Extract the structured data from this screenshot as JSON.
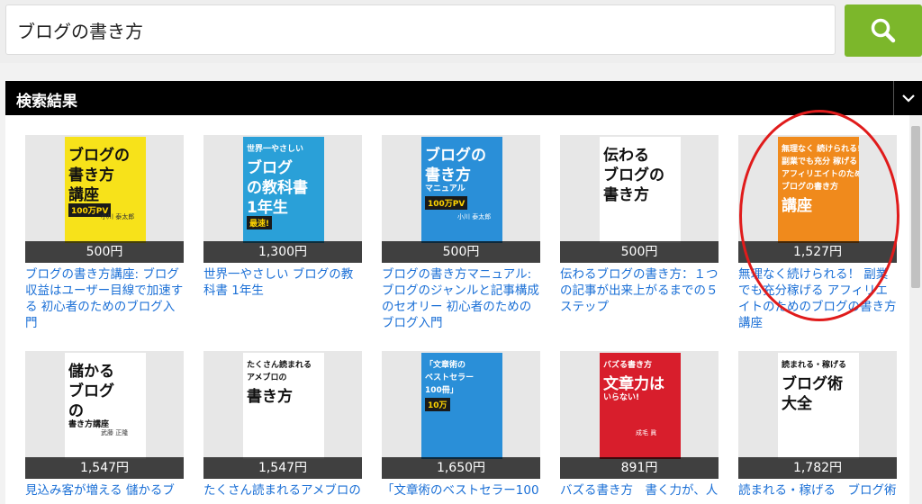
{
  "search": {
    "query": "ブログの書き方",
    "button_icon": "search-icon"
  },
  "results": {
    "header": "検索結果"
  },
  "colors": {
    "accent_green": "#7cb72b",
    "link_blue": "#1a6fd6",
    "annotation_red": "#e01b1b"
  },
  "books": [
    {
      "price": "500円",
      "title": "ブログの書き方講座: ブログ収益はユーザー目線で加速する 初心者のためのブログ入門",
      "cover": {
        "lines": [
          "ブログの",
          "書き方",
          "講座"
        ],
        "author": "小川 泰太郎",
        "banner": "100万PV",
        "bg": "#f7e21a"
      }
    },
    {
      "price": "1,300円",
      "title": "世界一やさしい ブログの教科書 1年生",
      "cover": {
        "lines": [
          "世界一やさしい",
          "ブログ",
          "の教科書",
          "1年生"
        ],
        "author": "",
        "banner": "最速!",
        "bg": "#2aa0d8"
      }
    },
    {
      "price": "500円",
      "title": "ブログの書き方マニュアル: ブログのジャンルと記事構成のセオリー 初心者のためのブログ入門",
      "cover": {
        "lines": [
          "ブログの",
          "書き方",
          "マニュアル"
        ],
        "author": "小川 泰太郎",
        "banner": "100万PV",
        "bg": "#2a8fd8"
      }
    },
    {
      "price": "500円",
      "title": "伝わるブログの書き方：１つの記事が出来上がるまでの５ステップ",
      "cover": {
        "lines": [
          "伝わる",
          "ブログの",
          "書き方"
        ],
        "author": "",
        "banner": "",
        "bg": "#ffffff"
      }
    },
    {
      "price": "1,527円",
      "title": "無理なく続けられる！ 副業でも充分稼げる アフィリエイトのためのブログの書き方講座",
      "cover": {
        "lines": [
          "無理なく 続けられる!",
          "副業でも充分 稼げる",
          "アフィリエイトのための",
          "ブログの書き方",
          "講座"
        ],
        "author": "",
        "banner": "",
        "bg": "#f08a1c"
      }
    },
    {
      "price": "1,547円",
      "title": "見込み客が増える 儲かるブ",
      "cover": {
        "lines": [
          "儲かる",
          "ブログ",
          "の",
          "書き方講座"
        ],
        "author": "武藤 正隆",
        "banner": "",
        "bg": "#ffffff"
      }
    },
    {
      "price": "1,547円",
      "title": "たくさん読まれるアメブロの",
      "cover": {
        "lines": [
          "たくさん読まれる",
          "アメブロの",
          "書き方"
        ],
        "author": "",
        "banner": "",
        "bg": "#ffffff"
      }
    },
    {
      "price": "1,650円",
      "title": "「文章術のベストセラー100",
      "cover": {
        "lines": [
          "「文章術の",
          "ベストセラー",
          "100冊」"
        ],
        "author": "",
        "banner": "10万",
        "bg": "#2a8fd8"
      }
    },
    {
      "price": "891円",
      "title": "バズる書き方　書く力が、人",
      "cover": {
        "lines": [
          "バズる書き方",
          "文章力は",
          "いらない!"
        ],
        "author": "成毛 眞",
        "banner": "",
        "bg": "#d81e2c"
      }
    },
    {
      "price": "1,782円",
      "title": "読まれる・稼げる　ブログ術",
      "cover": {
        "lines": [
          "読まれる・稼げる",
          "ブログ術",
          "大全"
        ],
        "author": "",
        "banner": "",
        "bg": "#ffffff"
      }
    }
  ]
}
